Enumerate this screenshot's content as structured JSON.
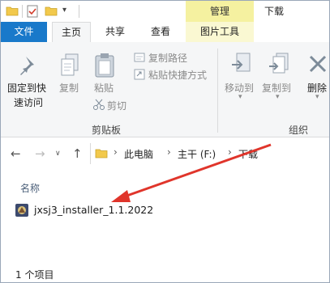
{
  "titlebar": {
    "contextual_tab": "管理",
    "window_title": "下载",
    "icons": [
      "folder-icon",
      "properties-icon",
      "new-folder-icon",
      "customize-qat-icon"
    ]
  },
  "tabs": {
    "file": "文件",
    "home": "主页",
    "share": "共享",
    "view": "查看",
    "picture_tools": "图片工具"
  },
  "ribbon": {
    "pin": "固定到快速访问",
    "pin_line1": "固定到快",
    "pin_line2": "速访问",
    "copy": "复制",
    "paste": "粘贴",
    "copy_path": "复制路径",
    "paste_shortcut": "粘贴快捷方式",
    "cut": "剪切",
    "move_to": "移动到",
    "copy_to": "复制到",
    "delete": "删除",
    "group_clipboard": "剪贴板",
    "group_organize": "组织"
  },
  "address": {
    "breadcrumb": [
      "此电脑",
      "主干 (F:)",
      "下载"
    ]
  },
  "list": {
    "column_name": "名称",
    "files": [
      {
        "name": "jxsj3_installer_1.1.2022",
        "icon": "installer-icon"
      }
    ]
  },
  "status": {
    "item_count": "1 个项目"
  },
  "colors": {
    "file_tab": "#1979ca",
    "contextual_tab": "#f5f1a0",
    "annotation_arrow": "#e0352b"
  }
}
